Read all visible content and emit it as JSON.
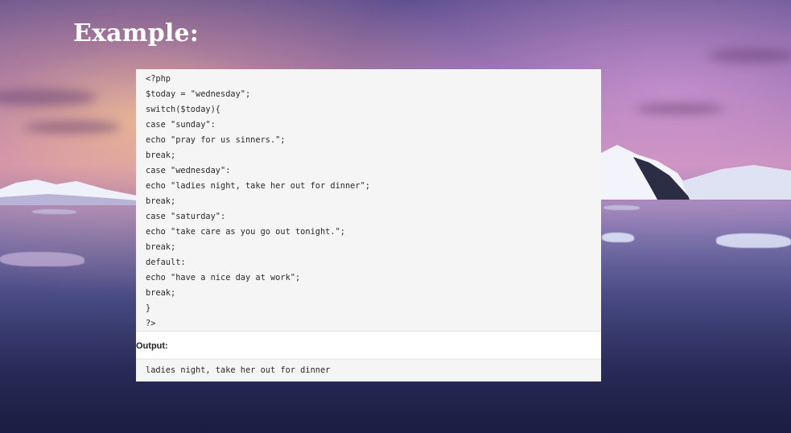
{
  "slide": {
    "title": "Example:"
  },
  "code_block": {
    "lines": [
      "<?php",
      "$today = \"wednesday\";",
      "switch($today){",
      "case \"sunday\":",
      "echo \"pray for us sinners.\";",
      "break;",
      "case \"wednesday\":",
      "echo \"ladies night, take her out for dinner\";",
      "break;",
      "case \"saturday\":",
      "echo \"take care as you go out tonight.\";",
      "break;",
      "default:",
      "echo \"have a nice day at work\";",
      "break;",
      "}",
      "?>"
    ]
  },
  "output": {
    "label": "Output:",
    "text": "ladies night, take her out for dinner"
  }
}
